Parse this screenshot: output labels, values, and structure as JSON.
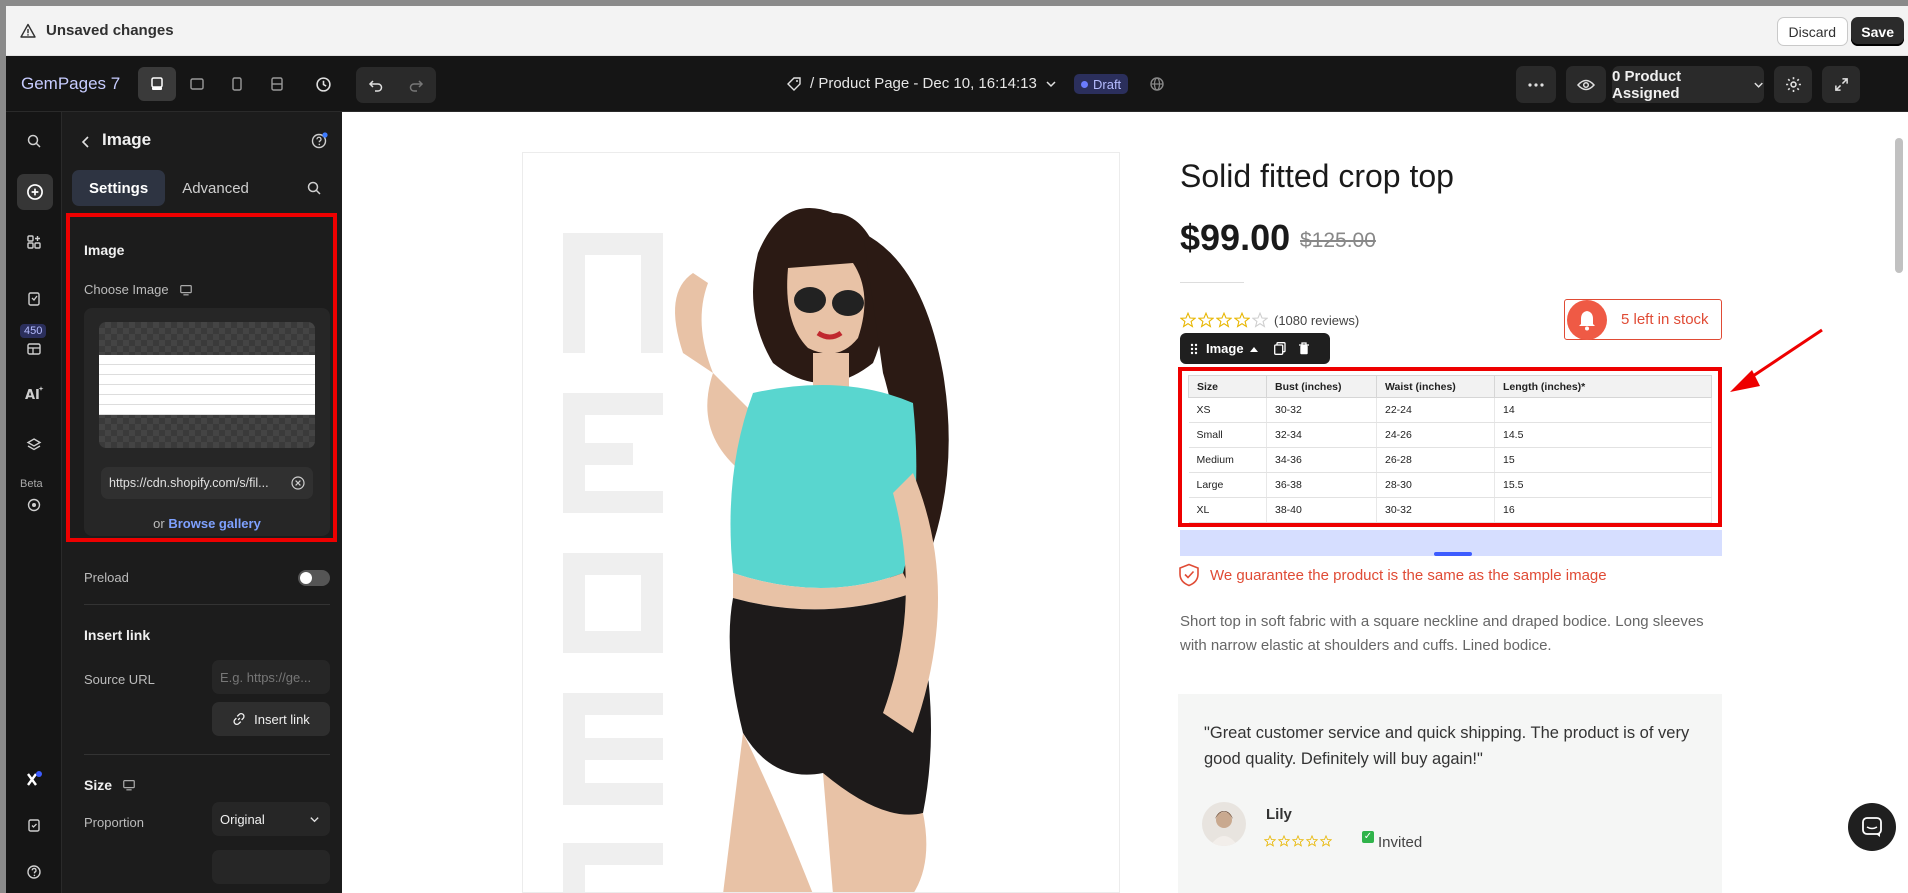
{
  "unsaved_bar": {
    "message": "Unsaved changes",
    "discard_label": "Discard",
    "save_label": "Save"
  },
  "toolbar": {
    "brand": "GemPages 7",
    "page_title": "/ Product Page - Dec 10, 16:14:13",
    "status_badge": "Draft",
    "product_assigned": "0 Product Assigned"
  },
  "rail": {
    "badge_count": "450",
    "beta_label": "Beta"
  },
  "panel": {
    "title": "Image",
    "tabs": [
      {
        "label": "Settings"
      },
      {
        "label": "Advanced"
      }
    ],
    "image_section_title": "Image",
    "choose_image_label": "Choose Image",
    "image_url": "https://cdn.shopify.com/s/fil...",
    "or_text": "or",
    "browse_gallery": "Browse gallery",
    "preload_label": "Preload",
    "insert_link_title": "Insert link",
    "source_url_label": "Source URL",
    "source_url_placeholder": "E.g. https://ge...",
    "insert_link_button": "Insert link",
    "size_title": "Size",
    "proportion_label": "Proportion",
    "proportion_value": "Original"
  },
  "product": {
    "title": "Solid fitted crop top",
    "price": "$99.00",
    "compare_price": "$125.00",
    "reviews": "(1080 reviews)",
    "rating_stars": 4,
    "stock": "5 left in stock",
    "image_toolbar_label": "Image",
    "guarantee": "We guarantee the product is the same as the sample image",
    "description": "Short top in soft fabric with a square neckline and draped bodice. Long sleeves with narrow elastic at shoulders and cuffs. Lined bodice."
  },
  "size_table": {
    "headers": [
      "Size",
      "Bust (inches)",
      "Waist (inches)",
      "Length (inches)*"
    ],
    "rows": [
      [
        "XS",
        "30-32",
        "22-24",
        "14"
      ],
      [
        "Small",
        "32-34",
        "24-26",
        "14.5"
      ],
      [
        "Medium",
        "34-36",
        "26-28",
        "15"
      ],
      [
        "Large",
        "36-38",
        "28-30",
        "15.5"
      ],
      [
        "XL",
        "38-40",
        "30-32",
        "16"
      ]
    ]
  },
  "review": {
    "quote": "\"Great customer service and quick shipping. The product is of very good quality. Definitely will buy again!\"",
    "name": "Lily",
    "invited": "Invited"
  },
  "colors": {
    "accent": "#7ea1ff",
    "highlight": "#ee0000",
    "stock_red": "#e04b35",
    "brand": "#c7ccff"
  }
}
